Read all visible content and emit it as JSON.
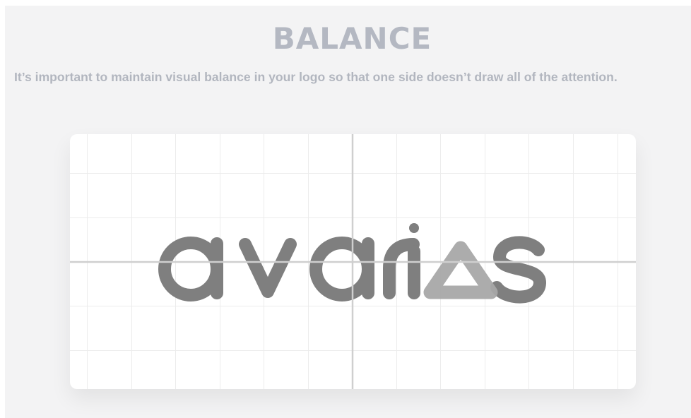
{
  "section": {
    "title": "BALANCE",
    "description": "It’s important to maintain visual balance in your logo so that one side doesn’t draw all of the attention."
  },
  "logo": {
    "wordmark": "avarias",
    "letter_color": "#7f7f7f",
    "triangle_color": "#a8a8a8"
  },
  "colors": {
    "background": "#f3f3f4",
    "card": "#ffffff",
    "heading": "#b4b8c2",
    "grid_line": "#ececec",
    "axis_line": "#cfcfcf"
  }
}
